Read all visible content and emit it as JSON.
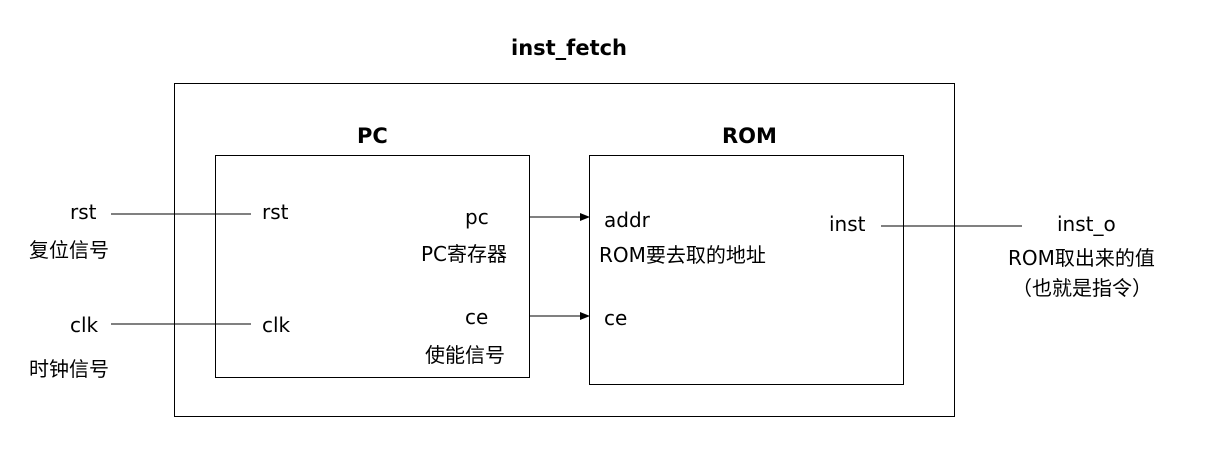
{
  "outer": {
    "title": "inst_fetch"
  },
  "pc": {
    "title": "PC",
    "port_rst": "rst",
    "port_clk": "clk",
    "port_pc": "pc",
    "port_pc_desc": "PC寄存器",
    "port_ce": "ce",
    "port_ce_desc": "使能信号"
  },
  "rom": {
    "title": "ROM",
    "port_addr": "addr",
    "port_addr_desc": "ROM要去取的地址",
    "port_ce": "ce",
    "port_inst": "inst"
  },
  "inputs": {
    "rst": "rst",
    "rst_desc": "复位信号",
    "clk": "clk",
    "clk_desc": "时钟信号"
  },
  "outputs": {
    "inst_o": "inst_o",
    "inst_o_desc1": "ROM取出来的值",
    "inst_o_desc2": "（也就是指令）"
  }
}
